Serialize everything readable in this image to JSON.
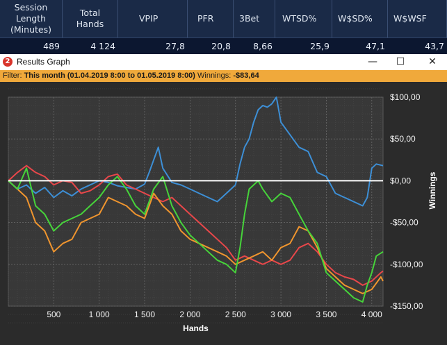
{
  "stats": {
    "headers": [
      {
        "key": "session_length",
        "lines": [
          "Session",
          "Length",
          "(Minutes)"
        ]
      },
      {
        "key": "total_hands",
        "lines": [
          "Total",
          "Hands"
        ]
      },
      {
        "key": "vpip",
        "lines": [
          "VPIP"
        ]
      },
      {
        "key": "pfr",
        "lines": [
          "PFR"
        ]
      },
      {
        "key": "three_bet",
        "lines": [
          "3Bet"
        ]
      },
      {
        "key": "wtsd",
        "lines": [
          "WTSD%"
        ]
      },
      {
        "key": "wsd",
        "lines": [
          "W$SD%"
        ]
      },
      {
        "key": "wswsf",
        "lines": [
          "W$WSF"
        ]
      }
    ],
    "values": [
      "489",
      "4 124",
      "27,8",
      "20,8",
      "8,66",
      "25,9",
      "47,1",
      "43,7"
    ]
  },
  "window": {
    "title": "Results Graph",
    "minimize_glyph": "—",
    "maximize_glyph": "☐",
    "close_glyph": "✕"
  },
  "filter": {
    "label": "Filter:",
    "range": "This month (01.04.2019 8:00 to 01.05.2019 8:00)",
    "winnings_label": "Winnings:",
    "winnings_value": "-$83,64"
  },
  "chart_data": {
    "type": "line",
    "xlabel": "Hands",
    "ylabel": "Winnings",
    "xlim": [
      0,
      4124
    ],
    "ylim": [
      -150,
      100
    ],
    "x_ticks": [
      500,
      1000,
      1500,
      2000,
      2500,
      3000,
      3500,
      4000
    ],
    "x_tick_labels": [
      "500",
      "1 000",
      "1 500",
      "2 000",
      "2 500",
      "3 000",
      "3 500",
      "4 000"
    ],
    "y_ticks": [
      100,
      50,
      0,
      -50,
      -100,
      -150
    ],
    "y_tick_labels": [
      "$100,00",
      "$50,00",
      "$0,00",
      "-$50,00",
      "-$100,00",
      "-$150,00"
    ],
    "grid": true,
    "zero_line": true,
    "series": [
      {
        "color": "#3d8fd6",
        "x": [
          0,
          100,
          200,
          300,
          400,
          500,
          600,
          700,
          800,
          900,
          1000,
          1100,
          1200,
          1300,
          1400,
          1500,
          1550,
          1600,
          1650,
          1700,
          1800,
          1900,
          2000,
          2100,
          2200,
          2300,
          2400,
          2500,
          2550,
          2600,
          2650,
          2700,
          2750,
          2800,
          2850,
          2900,
          2950,
          3000,
          3100,
          3200,
          3300,
          3400,
          3500,
          3600,
          3700,
          3800,
          3900,
          3950,
          4000,
          4050,
          4124
        ],
        "y": [
          0,
          -10,
          -5,
          -15,
          -8,
          -20,
          -12,
          -18,
          -10,
          -5,
          0,
          -2,
          -6,
          -8,
          -10,
          -4,
          10,
          25,
          40,
          15,
          -2,
          -5,
          -10,
          -15,
          -20,
          -25,
          -15,
          -5,
          20,
          40,
          50,
          70,
          85,
          90,
          88,
          92,
          100,
          70,
          55,
          40,
          35,
          10,
          5,
          -15,
          -20,
          -25,
          -30,
          -20,
          15,
          20,
          18
        ]
      },
      {
        "color": "#e8474a",
        "x": [
          0,
          100,
          200,
          300,
          400,
          500,
          600,
          700,
          800,
          900,
          1000,
          1100,
          1200,
          1300,
          1400,
          1500,
          1600,
          1700,
          1800,
          1900,
          2000,
          2100,
          2200,
          2300,
          2400,
          2500,
          2600,
          2700,
          2800,
          2900,
          3000,
          3100,
          3200,
          3300,
          3400,
          3500,
          3600,
          3700,
          3800,
          3900,
          4000,
          4100,
          4124
        ],
        "y": [
          0,
          10,
          18,
          10,
          5,
          -5,
          0,
          -2,
          -15,
          -12,
          -5,
          5,
          8,
          -5,
          -10,
          -15,
          -20,
          -25,
          -20,
          -30,
          -40,
          -50,
          -60,
          -70,
          -80,
          -95,
          -90,
          -95,
          -100,
          -95,
          -100,
          -95,
          -80,
          -75,
          -85,
          -100,
          -110,
          -115,
          -118,
          -125,
          -120,
          -110,
          -108
        ]
      },
      {
        "color": "#f0952e",
        "x": [
          0,
          100,
          200,
          300,
          400,
          500,
          600,
          700,
          800,
          900,
          1000,
          1100,
          1200,
          1300,
          1400,
          1500,
          1600,
          1700,
          1800,
          1900,
          2000,
          2100,
          2200,
          2300,
          2400,
          2500,
          2600,
          2700,
          2800,
          2900,
          3000,
          3100,
          3200,
          3300,
          3400,
          3500,
          3600,
          3700,
          3800,
          3900,
          4000,
          4100,
          4124
        ],
        "y": [
          0,
          -10,
          -20,
          -50,
          -60,
          -85,
          -75,
          -70,
          -50,
          -45,
          -40,
          -20,
          -25,
          -30,
          -40,
          -45,
          -15,
          -30,
          -40,
          -60,
          -70,
          -75,
          -80,
          -85,
          -90,
          -100,
          -95,
          -90,
          -85,
          -95,
          -80,
          -75,
          -55,
          -60,
          -80,
          -105,
          -115,
          -125,
          -130,
          -135,
          -130,
          -115,
          -120
        ]
      },
      {
        "color": "#46d43a",
        "x": [
          0,
          100,
          200,
          300,
          400,
          500,
          600,
          700,
          800,
          900,
          1000,
          1100,
          1200,
          1300,
          1400,
          1500,
          1600,
          1700,
          1800,
          1900,
          2000,
          2100,
          2200,
          2300,
          2400,
          2500,
          2550,
          2600,
          2650,
          2700,
          2750,
          2800,
          2900,
          3000,
          3100,
          3200,
          3300,
          3400,
          3500,
          3600,
          3700,
          3800,
          3900,
          3950,
          4000,
          4050,
          4124
        ],
        "y": [
          0,
          -10,
          15,
          -30,
          -40,
          -60,
          -50,
          -45,
          -40,
          -30,
          -20,
          -5,
          5,
          -10,
          -30,
          -40,
          -10,
          5,
          -30,
          -50,
          -65,
          -75,
          -85,
          -95,
          -100,
          -110,
          -80,
          -40,
          -10,
          -5,
          0,
          -10,
          -25,
          -15,
          -20,
          -40,
          -60,
          -75,
          -110,
          -120,
          -130,
          -140,
          -145,
          -125,
          -110,
          -90,
          -85
        ]
      }
    ]
  }
}
